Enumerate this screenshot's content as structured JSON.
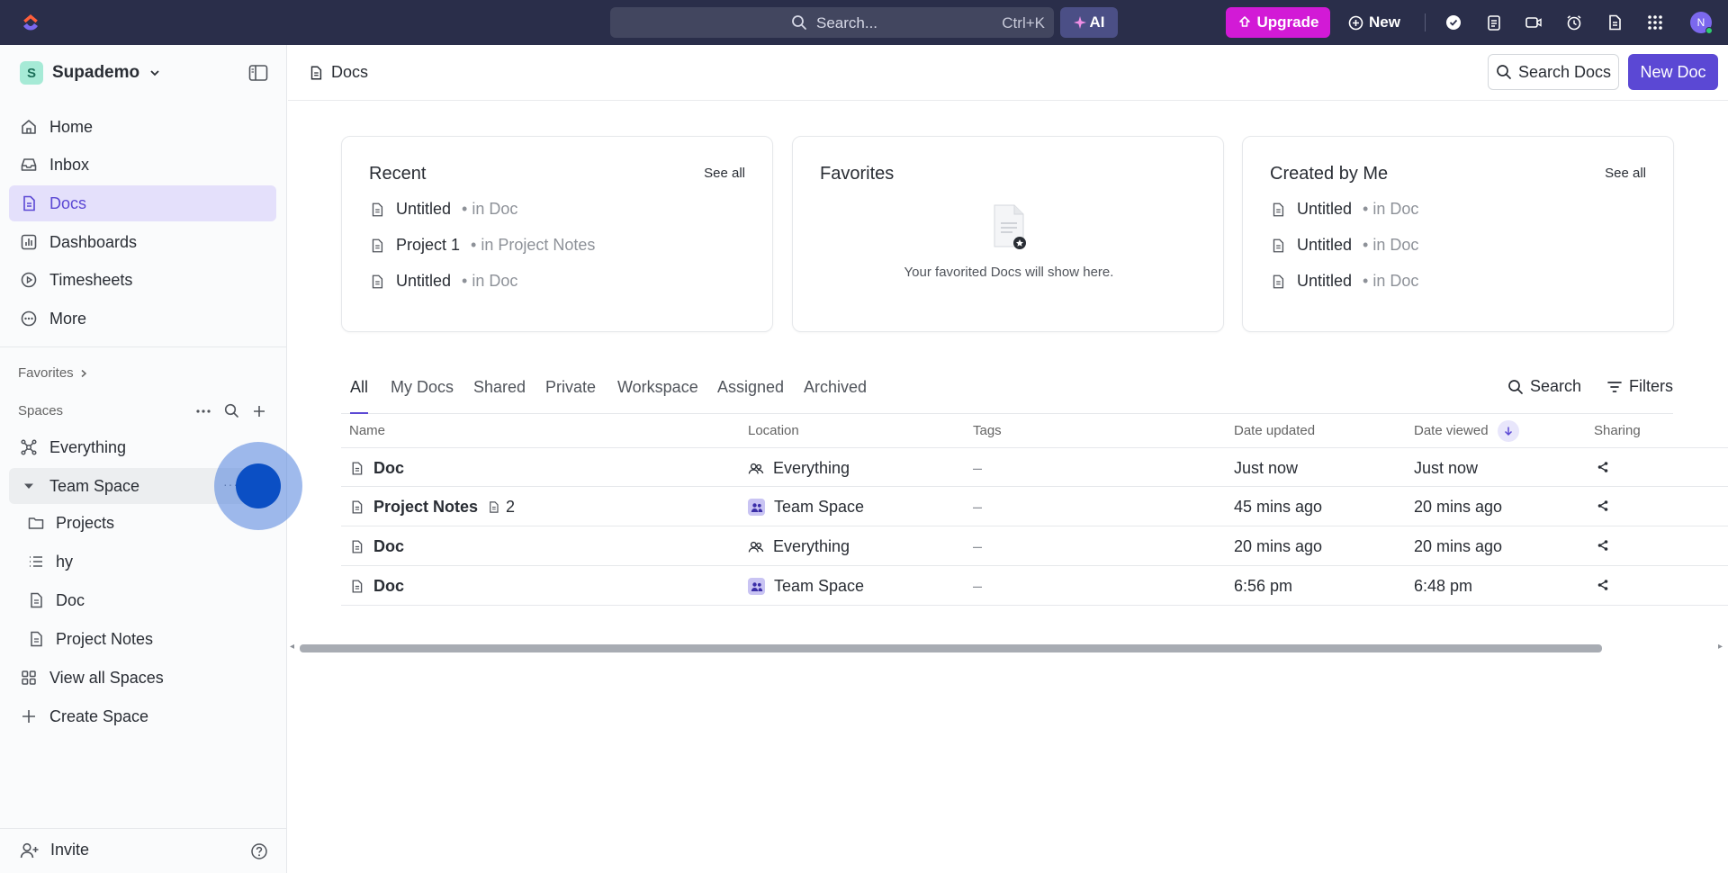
{
  "topbar": {
    "search_placeholder": "Search...",
    "search_shortcut": "Ctrl+K",
    "ai_label": "AI",
    "upgrade_label": "Upgrade",
    "new_label": "New",
    "avatar_initial": "N"
  },
  "sidebar": {
    "workspace_initial": "S",
    "workspace_name": "Supademo",
    "nav": [
      {
        "label": "Home"
      },
      {
        "label": "Inbox"
      },
      {
        "label": "Docs"
      },
      {
        "label": "Dashboards"
      },
      {
        "label": "Timesheets"
      },
      {
        "label": "More"
      }
    ],
    "favorites_label": "Favorites",
    "spaces_label": "Spaces",
    "spaces": [
      {
        "label": "Everything"
      },
      {
        "label": "Team Space"
      },
      {
        "label": "Projects"
      },
      {
        "label": "hy"
      },
      {
        "label": "Doc"
      },
      {
        "label": "Project Notes"
      },
      {
        "label": "View all Spaces"
      },
      {
        "label": "Create Space"
      }
    ],
    "invite_label": "Invite"
  },
  "header": {
    "breadcrumb": "Docs",
    "search_docs_label": "Search Docs",
    "new_doc_label": "New Doc"
  },
  "cards": {
    "recent": {
      "title": "Recent",
      "see_all": "See all",
      "items": [
        {
          "name": "Untitled",
          "where": "• in Doc"
        },
        {
          "name": "Project 1",
          "where": "• in Project Notes"
        },
        {
          "name": "Untitled",
          "where": "• in Doc"
        }
      ]
    },
    "favorites": {
      "title": "Favorites",
      "empty_text": "Your favorited Docs will show here."
    },
    "created": {
      "title": "Created by Me",
      "see_all": "See all",
      "items": [
        {
          "name": "Untitled",
          "where": "• in Doc"
        },
        {
          "name": "Untitled",
          "where": "• in Doc"
        },
        {
          "name": "Untitled",
          "where": "• in Doc"
        }
      ]
    }
  },
  "tabs": {
    "items": [
      "All",
      "My Docs",
      "Shared",
      "Private",
      "Workspace",
      "Assigned",
      "Archived"
    ],
    "search_label": "Search",
    "filters_label": "Filters"
  },
  "table": {
    "columns": [
      "Name",
      "Location",
      "Tags",
      "Date updated",
      "Date viewed",
      "Sharing"
    ],
    "rows": [
      {
        "name": "Doc",
        "subcount": "",
        "location": "Everything",
        "tags": "–",
        "updated": "Just now",
        "viewed": "Just now"
      },
      {
        "name": "Project Notes",
        "subcount": "2",
        "location": "Team Space",
        "tags": "–",
        "updated": "45 mins ago",
        "viewed": "20 mins ago"
      },
      {
        "name": "Doc",
        "subcount": "",
        "location": "Everything",
        "tags": "–",
        "updated": "20 mins ago",
        "viewed": "20 mins ago"
      },
      {
        "name": "Doc",
        "subcount": "",
        "location": "Team Space",
        "tags": "–",
        "updated": "6:56 pm",
        "viewed": "6:48 pm"
      }
    ]
  },
  "colors": {
    "topbar": "#2a2e4a",
    "accent": "#5b48d4",
    "upgrade": "#d21ad6"
  }
}
